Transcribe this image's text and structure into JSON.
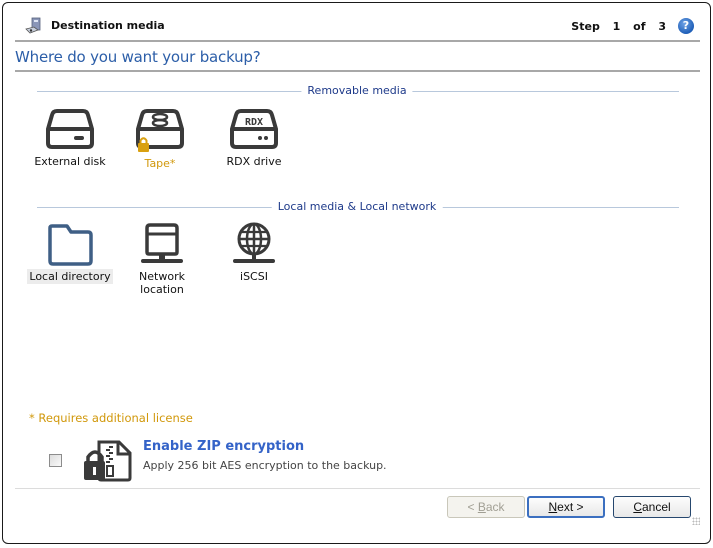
{
  "header": {
    "title": "Destination media",
    "step_word": "Step",
    "step_current": "1",
    "step_of": "of",
    "step_total": "3",
    "help_glyph": "?"
  },
  "question": "Where do you want your backup?",
  "groups": [
    {
      "title": "Removable media",
      "options": [
        {
          "label": "External disk",
          "icon": "external-disk-icon",
          "locked": false,
          "selected": false
        },
        {
          "label": "Tape*",
          "icon": "tape-icon",
          "locked": true,
          "selected": false
        },
        {
          "label": "RDX drive",
          "icon": "rdx-drive-icon",
          "icon_text": "RDX",
          "locked": false,
          "selected": false
        }
      ]
    },
    {
      "title": "Local media & Local network",
      "options": [
        {
          "label": "Local directory",
          "icon": "folder-icon",
          "locked": false,
          "selected": true
        },
        {
          "label": "Network location",
          "icon": "network-location-icon",
          "locked": false,
          "selected": false
        },
        {
          "label": "iSCSI",
          "icon": "globe-icon",
          "locked": false,
          "selected": false
        }
      ]
    }
  ],
  "license_note": "* Requires additional license",
  "encryption": {
    "checked": false,
    "title": "Enable ZIP encryption",
    "description": "Apply 256 bit AES encryption to the backup."
  },
  "buttons": {
    "back": {
      "prefix": "< ",
      "mnemonic": "B",
      "rest": "ack",
      "enabled": false
    },
    "next": {
      "prefix": "",
      "mnemonic": "N",
      "rest": "ext >",
      "enabled": true
    },
    "cancel": {
      "prefix": "",
      "mnemonic": "C",
      "rest": "ancel",
      "enabled": true
    }
  },
  "colors": {
    "accent_blue": "#2c5ea8",
    "group_title": "#1e3a8a",
    "license_orange": "#d1980b",
    "icon_dark": "#3a3a3a",
    "folder_blue": "#3f5f85"
  }
}
